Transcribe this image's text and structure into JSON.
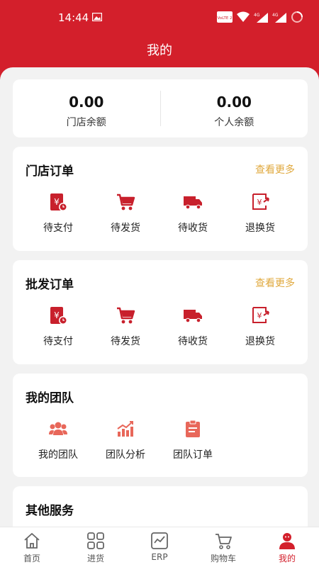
{
  "status": {
    "time": "14:44",
    "network_badge": "VoLTE 2",
    "net_a": "4G",
    "net_b": "4G"
  },
  "header": {
    "title": "我的"
  },
  "balance": {
    "store_value": "0.00",
    "store_label": "门店余额",
    "personal_value": "0.00",
    "personal_label": "个人余额"
  },
  "store_orders": {
    "title": "门店订单",
    "more": "查看更多",
    "items": [
      {
        "label": "待支付",
        "icon": "pending-payment-icon"
      },
      {
        "label": "待发货",
        "icon": "cart-icon"
      },
      {
        "label": "待收货",
        "icon": "truck-icon"
      },
      {
        "label": "退换货",
        "icon": "return-icon"
      }
    ]
  },
  "wholesale_orders": {
    "title": "批发订单",
    "more": "查看更多",
    "items": [
      {
        "label": "待支付",
        "icon": "pending-payment-icon"
      },
      {
        "label": "待发货",
        "icon": "cart-icon"
      },
      {
        "label": "待收货",
        "icon": "truck-icon"
      },
      {
        "label": "退换货",
        "icon": "return-icon"
      }
    ]
  },
  "team": {
    "title": "我的团队",
    "items": [
      {
        "label": "我的团队",
        "icon": "group-icon"
      },
      {
        "label": "团队分析",
        "icon": "bar-chart-icon"
      },
      {
        "label": "团队订单",
        "icon": "clipboard-icon"
      }
    ]
  },
  "other": {
    "title": "其他服务"
  },
  "tabbar": {
    "items": [
      {
        "label": "首页",
        "icon": "home-icon"
      },
      {
        "label": "进货",
        "icon": "grid-icon"
      },
      {
        "label": "ERP",
        "icon": "erp-chart-icon"
      },
      {
        "label": "购物车",
        "icon": "cart-outline-icon"
      },
      {
        "label": "我的",
        "icon": "person-icon",
        "active": true
      }
    ]
  },
  "colors": {
    "brand": "#d31f2b",
    "icon_red": "#c8202c",
    "link_gold": "#e0a93e",
    "team_icon": "#e8675a"
  }
}
